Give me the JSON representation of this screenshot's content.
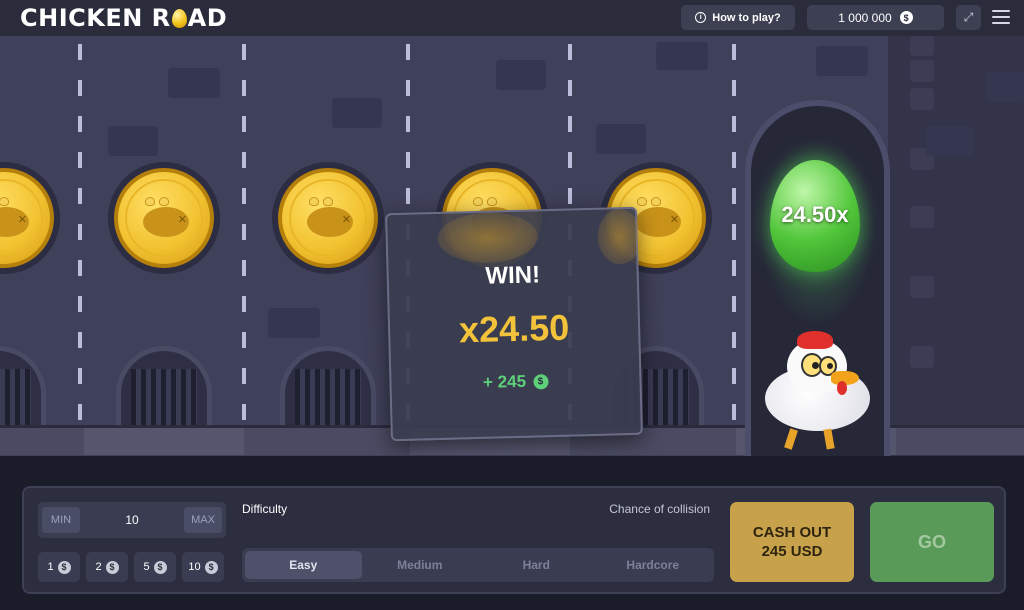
{
  "header": {
    "logo_left": "CHICKEN R",
    "logo_right": "AD",
    "how_to_play": "How to play?",
    "balance": "1 000 000",
    "currency_symbol": "$"
  },
  "field": {
    "goal_multiplier": "24.50x"
  },
  "popup": {
    "title": "WIN!",
    "multiplier": "x24.50",
    "gain": "+ 245",
    "currency_symbol": "$"
  },
  "controls": {
    "min_label": "MIN",
    "max_label": "MAX",
    "bet_value": "10",
    "quick_bets": [
      "1",
      "2",
      "5",
      "10"
    ],
    "currency_symbol": "$",
    "difficulty_label": "Difficulty",
    "chance_label": "Chance of collision",
    "difficulties": [
      "Easy",
      "Medium",
      "Hard",
      "Hardcore"
    ],
    "active_difficulty": "Easy",
    "cashout_line1": "CASH OUT",
    "cashout_line2": "245 USD",
    "go_label": "GO"
  },
  "colors": {
    "accent_gold": "#f2c23a",
    "win_green": "#5ed07a",
    "cashout": "#c8a24a",
    "go": "#5a9a58"
  }
}
